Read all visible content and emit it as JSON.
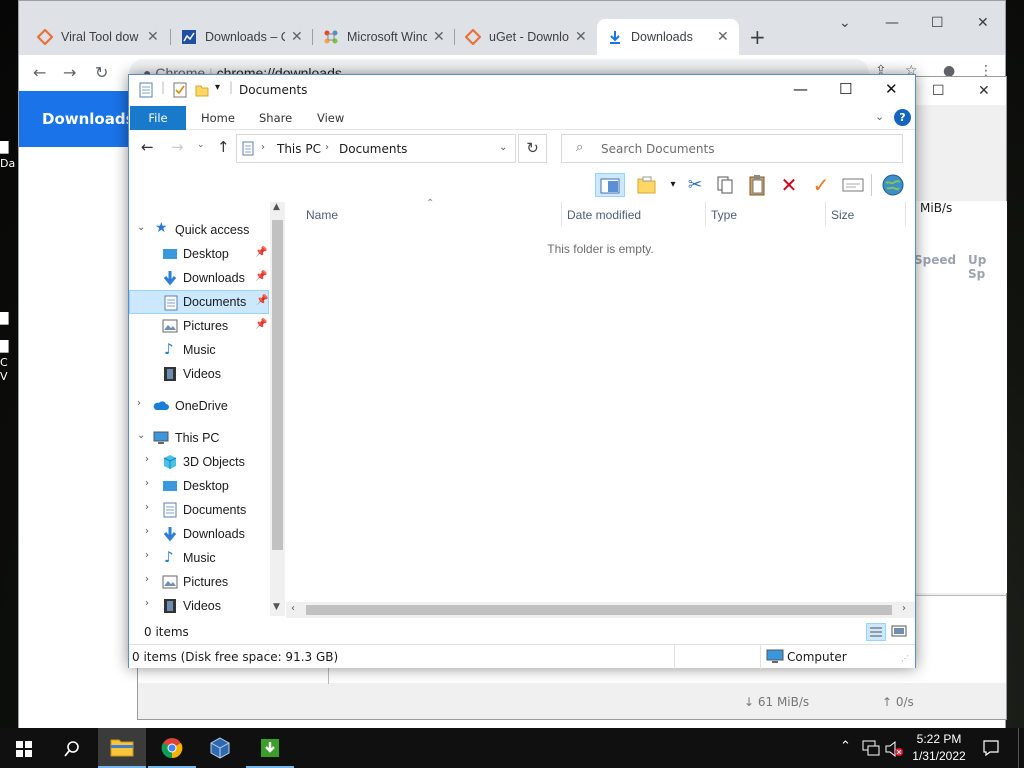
{
  "desktop": {
    "fragments": [
      "Da",
      "C",
      "V"
    ]
  },
  "chrome": {
    "tabs": [
      {
        "title": "Viral Tool dow",
        "favicon": "diamond-orange-icon"
      },
      {
        "title": "Downloads – C",
        "favicon": "chart-blue-icon"
      },
      {
        "title": "Microsoft Wind",
        "favicon": "joomla-icon"
      },
      {
        "title": "uGet - Downlo",
        "favicon": "diamond-orange-icon"
      },
      {
        "title": "Downloads",
        "favicon": "download-arrow-icon"
      }
    ],
    "address": {
      "scheme_label": "Chrome",
      "url": "chrome://downloads"
    },
    "page_heading": "Downloads"
  },
  "uget": {
    "columns": [
      "Speed",
      "Up Sp"
    ],
    "speed_value": "MiB/s",
    "status_down": "↓ 61 MiB/s",
    "status_up": "↑ 0/s"
  },
  "explorer": {
    "title": "Documents",
    "ribbon": {
      "file": "File",
      "home": "Home",
      "share": "Share",
      "view": "View"
    },
    "breadcrumb": [
      "This PC",
      "Documents"
    ],
    "search_placeholder": "Search Documents",
    "columns": {
      "name": "Name",
      "date": "Date modified",
      "type": "Type",
      "size": "Size"
    },
    "empty_message": "This folder is empty.",
    "nav": {
      "quick_access": "Quick access",
      "qa_items": [
        {
          "label": "Desktop",
          "icon": "desktop-icon"
        },
        {
          "label": "Downloads",
          "icon": "download-icon"
        },
        {
          "label": "Documents",
          "icon": "documents-icon"
        },
        {
          "label": "Pictures",
          "icon": "pictures-icon"
        },
        {
          "label": "Music",
          "icon": "music-icon"
        },
        {
          "label": "Videos",
          "icon": "videos-icon"
        }
      ],
      "onedrive": "OneDrive",
      "this_pc": "This PC",
      "pc_items": [
        {
          "label": "3D Objects",
          "icon": "3d-objects-icon"
        },
        {
          "label": "Desktop",
          "icon": "desktop-icon"
        },
        {
          "label": "Documents",
          "icon": "documents-icon"
        },
        {
          "label": "Downloads",
          "icon": "download-icon"
        },
        {
          "label": "Music",
          "icon": "music-icon"
        },
        {
          "label": "Pictures",
          "icon": "pictures-icon"
        },
        {
          "label": "Videos",
          "icon": "videos-icon"
        }
      ]
    },
    "item_count": "0 items",
    "status_left": "0 items (Disk free space: 91.3 GB)",
    "status_right": "Computer"
  },
  "taskbar": {
    "time": "5:22 PM",
    "date": "1/31/2022"
  },
  "colors": {
    "accent": "#1979ca",
    "chrome_blue": "#1a73e8",
    "selection": "#cce8ff"
  }
}
